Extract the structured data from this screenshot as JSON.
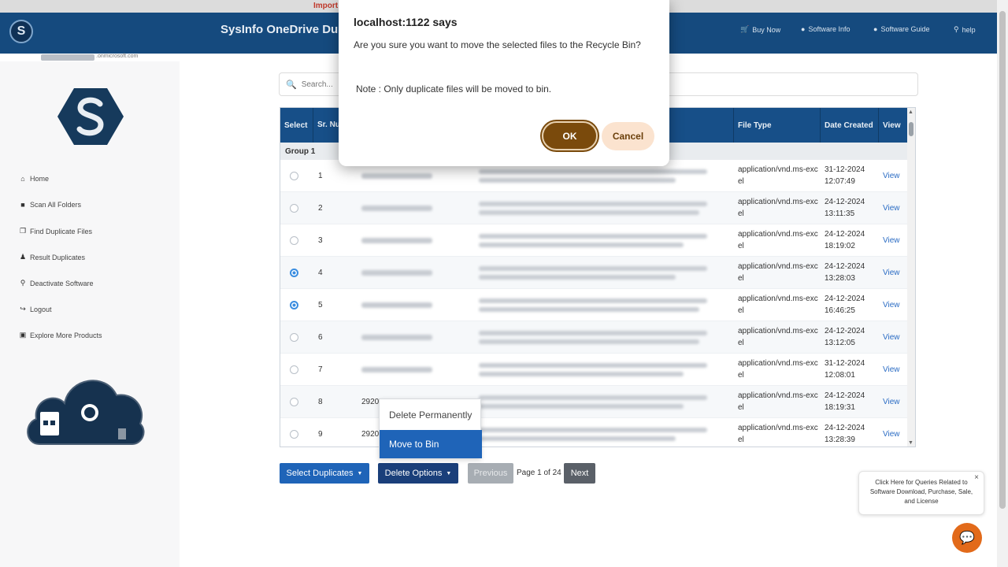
{
  "top_strip": {
    "notice": "Import"
  },
  "header": {
    "logo_letter": "S",
    "title": "SysInfo OneDrive Du",
    "nav": [
      {
        "label": "Buy Now",
        "icon": "cart-icon"
      },
      {
        "label": "Software Info",
        "icon": "info-icon"
      },
      {
        "label": "Software Guide",
        "icon": "guide-icon"
      },
      {
        "label": "help",
        "icon": "help-icon"
      }
    ],
    "user_domain": ".onmicrosoft.com"
  },
  "sidebar": {
    "items": [
      {
        "label": "Home",
        "icon": "home-icon"
      },
      {
        "label": "Scan All Folders",
        "icon": "folder-icon"
      },
      {
        "label": "Find Duplicate Files",
        "icon": "files-icon"
      },
      {
        "label": "Result Duplicates",
        "icon": "user-icon"
      },
      {
        "label": "Deactivate Software",
        "icon": "key-icon"
      },
      {
        "label": "Logout",
        "icon": "logout-icon"
      },
      {
        "label": "Explore More Products",
        "icon": "briefcase-icon"
      }
    ]
  },
  "search": {
    "placeholder": "Search..."
  },
  "table": {
    "headers": [
      "Select",
      "Sr. Numb",
      "",
      "",
      "File Type",
      "Date Created",
      "View"
    ],
    "group_label": "Group 1",
    "rows": [
      {
        "sr": "1",
        "selected": false,
        "name": "",
        "type": "application/vnd.ms-excel",
        "date": "31-12-2024",
        "time": "12:07:49",
        "view": "View"
      },
      {
        "sr": "2",
        "selected": false,
        "name": "",
        "type": "application/vnd.ms-excel",
        "date": "24-12-2024",
        "time": "13:11:35",
        "view": "View"
      },
      {
        "sr": "3",
        "selected": false,
        "name": "",
        "type": "application/vnd.ms-excel",
        "date": "24-12-2024",
        "time": "18:19:02",
        "view": "View"
      },
      {
        "sr": "4",
        "selected": true,
        "name": "",
        "type": "application/vnd.ms-excel",
        "date": "24-12-2024",
        "time": "13:28:03",
        "view": "View"
      },
      {
        "sr": "5",
        "selected": true,
        "name": "",
        "type": "application/vnd.ms-excel",
        "date": "24-12-2024",
        "time": "16:46:25",
        "view": "View"
      },
      {
        "sr": "6",
        "selected": false,
        "name": "",
        "type": "application/vnd.ms-excel",
        "date": "24-12-2024",
        "time": "13:12:05",
        "view": "View"
      },
      {
        "sr": "7",
        "selected": false,
        "name": "",
        "type": "application/vnd.ms-excel",
        "date": "31-12-2024",
        "time": "12:08:01",
        "view": "View"
      },
      {
        "sr": "8",
        "selected": false,
        "name": "2920",
        "type": "application/vnd.ms-excel",
        "date": "24-12-2024",
        "time": "18:19:31",
        "view": "View"
      },
      {
        "sr": "9",
        "selected": false,
        "name": "2920",
        "type": "application/vnd.ms-excel",
        "date": "24-12-2024",
        "time": "13:28:39",
        "view": "View"
      }
    ]
  },
  "controls": {
    "select_duplicates": "Select Duplicates",
    "delete_options": "Delete Options",
    "previous": "Previous",
    "page_text": "Page 1 of 24",
    "next": "Next"
  },
  "dropdown": {
    "items": [
      "Delete Permanently",
      "Move to Bin"
    ],
    "active_index": 1
  },
  "chat": {
    "tip": "Click Here for Queries Related to Software Download, Purchase, Sale, and License",
    "close": "×"
  },
  "dialog": {
    "title": "localhost:1122 says",
    "message": "Are you sure you want to move the selected files to the Recycle Bin?",
    "note": "Note : Only duplicate files will be moved to bin.",
    "ok": "OK",
    "cancel": "Cancel"
  },
  "colors": {
    "header": "#154a7e",
    "table_header": "#174f88",
    "accent_blue": "#1f64b8",
    "ok_brown": "#7a4a0c",
    "cancel_peach": "#fbe3cf",
    "chat_orange": "#e26a1a"
  }
}
